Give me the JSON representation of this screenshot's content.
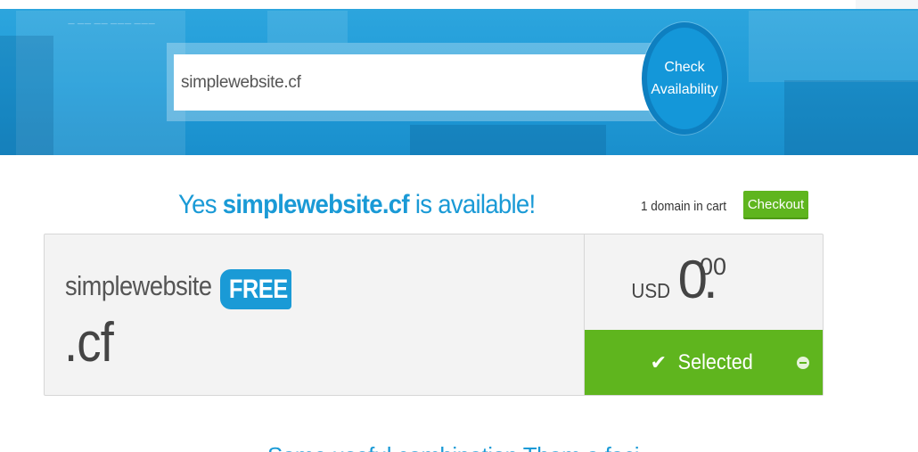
{
  "search": {
    "value": "simplewebsite.cf",
    "button_line1": "Check",
    "button_line2": "Availability"
  },
  "availability": {
    "prefix": "Yes",
    "domain": "simplewebsite.cf",
    "suffix": "is available!"
  },
  "cart": {
    "count_text": "1 domain in cart",
    "checkout_label": "Checkout"
  },
  "result": {
    "name": "simplewebsite",
    "badge": "FREE",
    "tld": ".cf",
    "currency": "USD",
    "price_whole": "0",
    "price_cents": "00",
    "selected_label": "Selected"
  },
  "footer": {
    "teaser": "Some useful combination Tham a foci"
  },
  "colors": {
    "brand_blue": "#1a9ad6",
    "accent_green": "#5fb51e"
  },
  "icons": [
    "check-icon",
    "remove-icon",
    "free-dot-icon"
  ]
}
